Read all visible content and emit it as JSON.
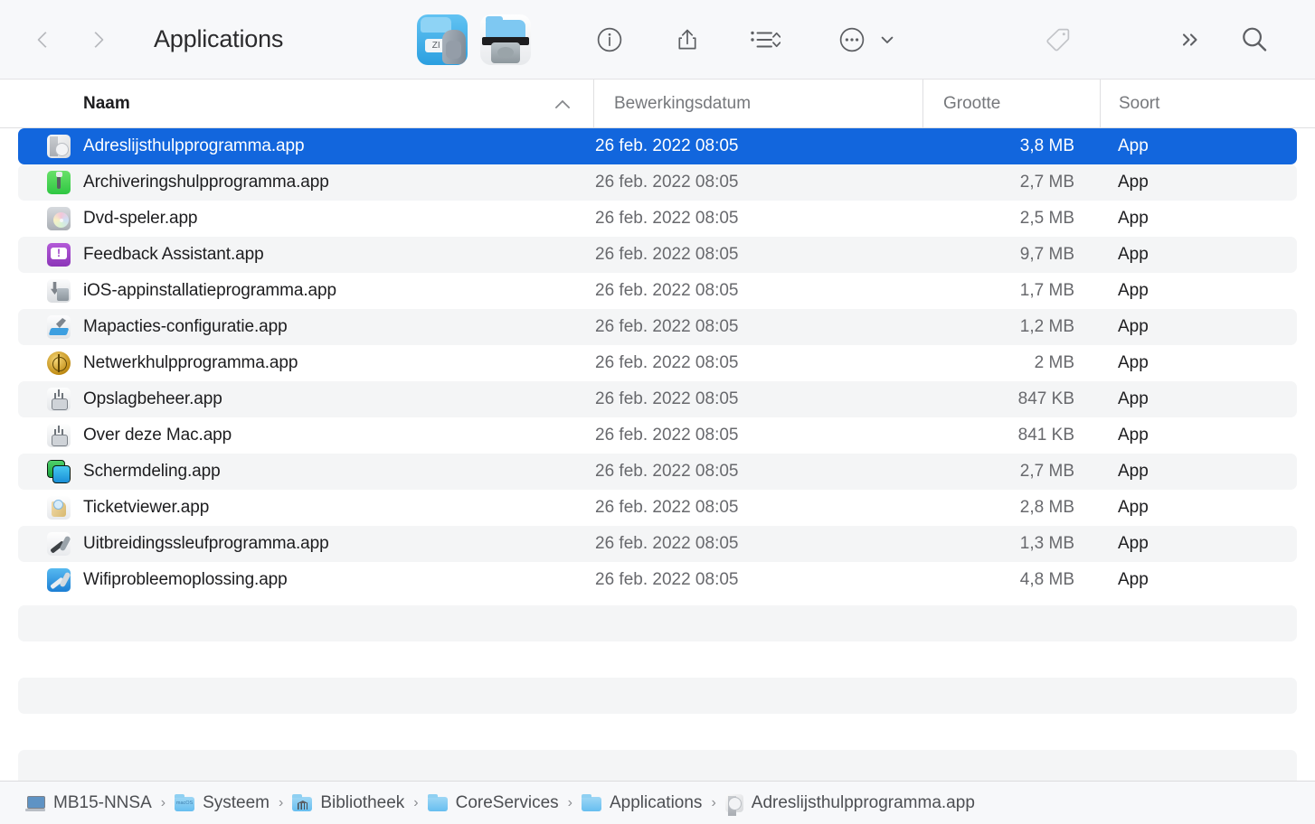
{
  "window": {
    "title": "Applications"
  },
  "toolbar": {
    "back_label": "Back",
    "forward_label": "Forward",
    "app_tiles": [
      {
        "name": "archive-utility-app-icon",
        "label": "Archiveringshulpprogramma",
        "zip_text": "ZI"
      },
      {
        "name": "printer-scanner-app-icon",
        "label": "Afdrukwachtrij"
      }
    ],
    "buttons": [
      {
        "icon": "info-icon",
        "label": "Info"
      },
      {
        "icon": "share-icon",
        "label": "Deel"
      },
      {
        "icon": "list-view-icon",
        "label": "Groepeer"
      },
      {
        "icon": "more-actions-icon",
        "label": "Meer"
      },
      {
        "icon": "tag-icon",
        "label": "Tags"
      },
      {
        "icon": "overflow-chevrons-icon",
        "label": "Meer opties"
      },
      {
        "icon": "search-icon",
        "label": "Zoek"
      }
    ]
  },
  "columns": {
    "name": "Naam",
    "date_modified": "Bewerkingsdatum",
    "size": "Grootte",
    "kind": "Soort",
    "sort_by": "Naam",
    "sort_direction": "ascending"
  },
  "files": [
    {
      "name": "Adreslijsthulpprogramma.app",
      "date": "26 feb. 2022 08:05",
      "size": "3,8 MB",
      "kind": "App",
      "icon": "addressbook-app-icon",
      "selected": true
    },
    {
      "name": "Archiveringshulpprogramma.app",
      "date": "26 feb. 2022 08:05",
      "size": "2,7 MB",
      "kind": "App",
      "icon": "archive-app-icon",
      "selected": false
    },
    {
      "name": "Dvd-speler.app",
      "date": "26 feb. 2022 08:05",
      "size": "2,5 MB",
      "kind": "App",
      "icon": "dvd-player-app-icon",
      "selected": false
    },
    {
      "name": "Feedback Assistant.app",
      "date": "26 feb. 2022 08:05",
      "size": "9,7 MB",
      "kind": "App",
      "icon": "feedback-assistant-app-icon",
      "selected": false
    },
    {
      "name": "iOS-appinstallatieprogramma.app",
      "date": "26 feb. 2022 08:05",
      "size": "1,7 MB",
      "kind": "App",
      "icon": "ios-app-installer-icon",
      "selected": false
    },
    {
      "name": "Mapacties-configuratie.app",
      "date": "26 feb. 2022 08:05",
      "size": "1,2 MB",
      "kind": "App",
      "icon": "folder-actions-setup-icon",
      "selected": false
    },
    {
      "name": "Netwerkhulpprogramma.app",
      "date": "26 feb. 2022 08:05",
      "size": "2 MB",
      "kind": "App",
      "icon": "network-utility-icon",
      "selected": false
    },
    {
      "name": "Opslagbeheer.app",
      "date": "26 feb. 2022 08:05",
      "size": "847 KB",
      "kind": "App",
      "icon": "storage-management-icon",
      "selected": false
    },
    {
      "name": "Over deze Mac.app",
      "date": "26 feb. 2022 08:05",
      "size": "841 KB",
      "kind": "App",
      "icon": "about-this-mac-icon",
      "selected": false
    },
    {
      "name": "Schermdeling.app",
      "date": "26 feb. 2022 08:05",
      "size": "2,7 MB",
      "kind": "App",
      "icon": "screen-sharing-icon",
      "selected": false
    },
    {
      "name": "Ticketviewer.app",
      "date": "26 feb. 2022 08:05",
      "size": "2,8 MB",
      "kind": "App",
      "icon": "ticket-viewer-icon",
      "selected": false
    },
    {
      "name": "Uitbreidingssleufprogramma.app",
      "date": "26 feb. 2022 08:05",
      "size": "1,3 MB",
      "kind": "App",
      "icon": "expansion-slot-utility-icon",
      "selected": false
    },
    {
      "name": "Wifiprobleemoplossing.app",
      "date": "26 feb. 2022 08:05",
      "size": "4,8 MB",
      "kind": "App",
      "icon": "wireless-diagnostics-icon",
      "selected": false
    }
  ],
  "breadcrumb": [
    {
      "label": "MB15-NNSA",
      "icon": "laptop-icon"
    },
    {
      "label": "Systeem",
      "icon": "macos-folder-icon"
    },
    {
      "label": "Bibliotheek",
      "icon": "library-folder-icon"
    },
    {
      "label": "CoreServices",
      "icon": "folder-icon"
    },
    {
      "label": "Applications",
      "icon": "folder-icon"
    },
    {
      "label": "Adreslijsthulpprogramma.app",
      "icon": "addressbook-app-icon"
    }
  ],
  "breadcrumb_separator": "›",
  "colors": {
    "selection_blue": "#1266dd",
    "toolbar_bg": "#f7f8fa",
    "stripe_bg": "#f4f5f6",
    "text_primary": "#1d1d1f",
    "text_secondary": "#68696d"
  }
}
